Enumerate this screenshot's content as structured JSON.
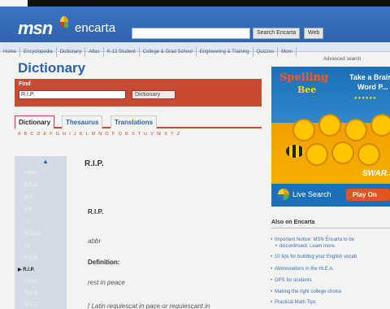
{
  "header": {
    "logo_msn": "msn",
    "logo_encarta": "encarta",
    "search_button": "Search Encarta",
    "web_button": "Web"
  },
  "nav": [
    "Home",
    "Encyclopedia",
    "Dictionary",
    "Atlas",
    "K-12 Student",
    "College & Grad School",
    "Engineering & Training",
    "Quizzes",
    "More"
  ],
  "adv_link": "Advanced search",
  "page_title": "Dictionary",
  "find": {
    "label": "Find",
    "value": "R.I.P.",
    "select_value": "Dictionary"
  },
  "tabs": [
    "Dictionary",
    "Thesaurus",
    "Translations"
  ],
  "alphabet": "A B C D E F G H I J K L M N O P Q R S T U V W X Y Z",
  "wordlist": {
    "arrow": "▲",
    "items": [
      "r-stan",
      "R.B.D.",
      "R.D.",
      "R.E.",
      "r.f.",
      "R Hertz",
      "r.s.",
      "R.S.B.",
      "R.I.P.",
      "r.m.m.",
      "R.N.B.",
      "R.N.C."
    ],
    "current_index": 8,
    "current_marker": "▶"
  },
  "entry": {
    "head": "R.I.P.",
    "word": "R.I.P.",
    "pos": "abbr",
    "def_label": "Definition:",
    "definition": "rest in peace",
    "etymology": "[ Latin requiescat in pace or requiescant in"
  },
  "ad": {
    "logo_line1": "Spelling",
    "logo_line2": "Bee",
    "line1": "Take a Brain",
    "line2": "Word P...",
    "swarm": "SWAR...",
    "live_search": "Live Search",
    "play": "Play On",
    "dots": "●●●●●●"
  },
  "also": {
    "title": "Also on Encarta",
    "items": [
      "Important Notice: MSN Encarta to be",
      "discontinued. Learn more.",
      "10 tips for building your English vocab",
      "Abbreviations in the Hi.E.A.",
      "GPS for students",
      "Making the right college choice",
      "Practical Math Tips"
    ]
  },
  "colors": {
    "header_blue": "#3b74c1",
    "find_red": "#c94a33",
    "title_blue": "#2b63ac"
  }
}
